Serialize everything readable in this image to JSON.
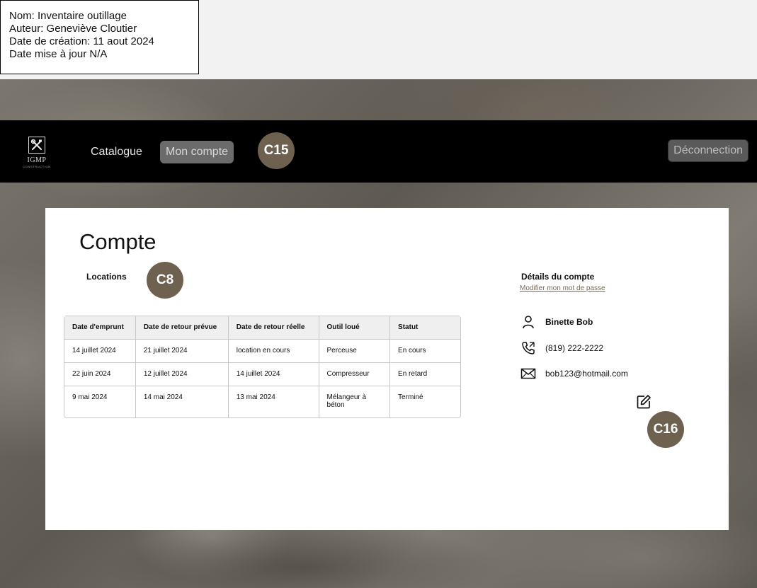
{
  "meta": {
    "name": "Nom: Inventaire outillage",
    "author": "Auteur: Geneviève Cloutier",
    "created": "Date de création: 11 aout 2024",
    "updated": "Date mise à jour N/A"
  },
  "nav": {
    "logo_text": "IGMP",
    "logo_sub": "CONSTRUCTION",
    "catalogue": "Catalogue",
    "account": "Mon compte",
    "logout": "Déconnection"
  },
  "markers": {
    "nav": "C15",
    "locations": "C8",
    "edit": "C16"
  },
  "page": {
    "title": "Compte",
    "locations_label": "Locations"
  },
  "rentals": {
    "headers": [
      "Date d'emprunt",
      "Date de retour prévue",
      "Date de retour réelle",
      "Outil loué",
      "Statut"
    ],
    "rows": [
      [
        "14 juillet 2024",
        "21 juillet 2024",
        "location en cours",
        "Perceuse",
        "En cours"
      ],
      [
        "22 juin 2024",
        "12 juillet 2024",
        "14 juillet 2024",
        "Compresseur",
        "En retard"
      ],
      [
        "9 mai 2024",
        "14 mai 2024",
        "13 mai 2024",
        "Mélangeur à béton",
        "Terminé"
      ]
    ]
  },
  "account": {
    "title": "Détails du compte",
    "change_password": "Modifier mon mot de passe",
    "name": "Binette Bob",
    "phone": "(819) 222-2222",
    "email": "bob123@hotmail.com"
  },
  "icons": {
    "user": "user-icon",
    "phone": "phone-icon",
    "mail": "mail-icon",
    "edit": "edit-icon",
    "logo": "tools-icon"
  },
  "colors": {
    "navbar": "#000000",
    "marker": "#6e6150",
    "active_tab": "#6b6b6b",
    "link": "#7a6a55"
  }
}
